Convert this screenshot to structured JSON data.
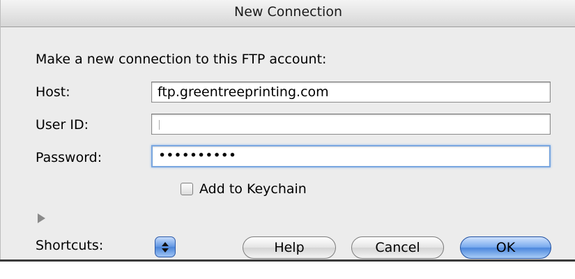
{
  "dialog": {
    "title": "New Connection",
    "prompt": "Make a new connection to this FTP account:",
    "host": {
      "label": "Host:",
      "value": "ftp.greentreeprinting.com"
    },
    "user_id": {
      "label": "User ID:",
      "value": ""
    },
    "password": {
      "label": "Password:",
      "value": "••••••••••"
    },
    "keychain_label": "Add to Keychain",
    "shortcuts_label": "Shortcuts:",
    "buttons": {
      "help": "Help",
      "cancel": "Cancel",
      "ok": "OK"
    }
  }
}
